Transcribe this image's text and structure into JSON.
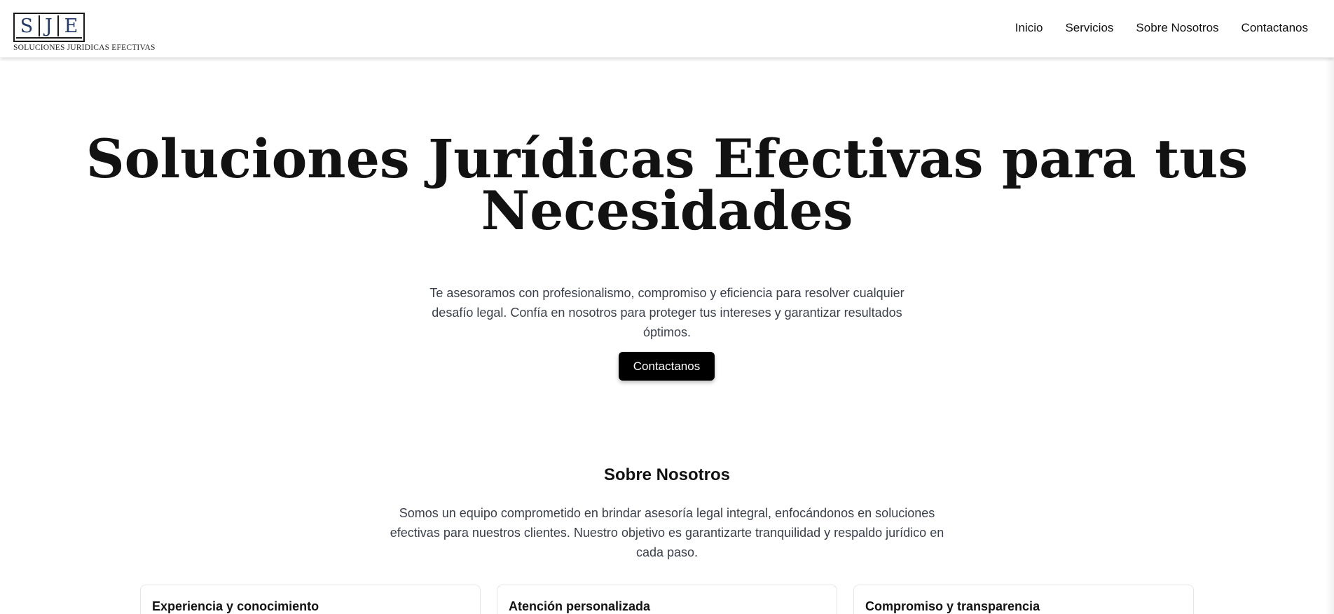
{
  "header": {
    "logo": {
      "letters": [
        "S",
        "J",
        "E"
      ],
      "subtitle": "SOLUCIONES JURIDICAS EFECTIVAS"
    },
    "nav": [
      "Inicio",
      "Servicios",
      "Sobre Nosotros",
      "Contactanos"
    ]
  },
  "hero": {
    "title": "Soluciones Jurídicas Efectivas para tus Necesidades",
    "text": "Te asesoramos con profesionalismo, compromiso y eficiencia para resolver cualquier desafío legal. Confía en nosotros para proteger tus intereses y garantizar resultados óptimos.",
    "cta_label": "Contactanos"
  },
  "about": {
    "title": "Sobre Nosotros",
    "text": "Somos un equipo comprometido en brindar asesoría legal integral, enfocándonos en soluciones efectivas para nuestros clientes. Nuestro objetivo es garantizarte tranquilidad y respaldo jurídico en cada paso.",
    "cards": [
      {
        "title": "Experiencia y conocimiento"
      },
      {
        "title": "Atención personalizada"
      },
      {
        "title": "Compromiso y transparencia"
      }
    ]
  },
  "colors": {
    "logo_letters": "#243a6b",
    "cta_background": "#000000",
    "body_text": "#3a3f4b"
  }
}
